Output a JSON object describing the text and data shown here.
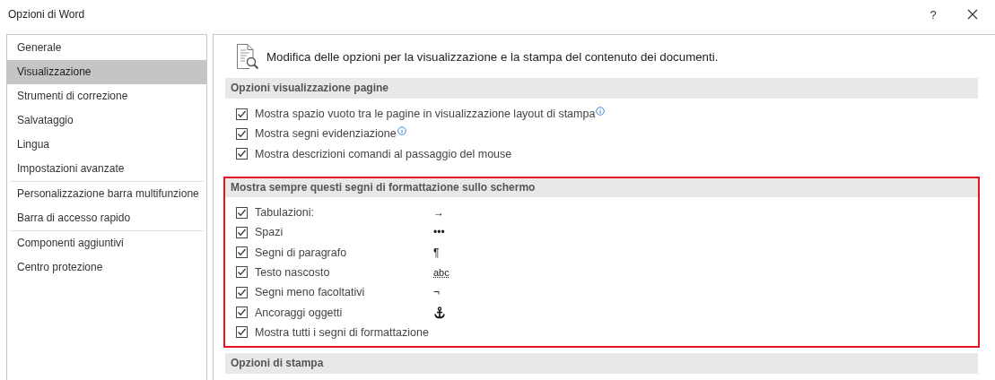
{
  "window": {
    "title": "Opzioni di Word",
    "help": "?"
  },
  "sidebar": {
    "groups": [
      [
        {
          "label": "Generale",
          "selected": false
        },
        {
          "label": "Visualizzazione",
          "selected": true
        },
        {
          "label": "Strumenti di correzione",
          "selected": false
        },
        {
          "label": "Salvataggio",
          "selected": false
        },
        {
          "label": "Lingua",
          "selected": false
        },
        {
          "label": "Impostazioni avanzate",
          "selected": false
        }
      ],
      [
        {
          "label": "Personalizzazione barra multifunzione",
          "selected": false
        },
        {
          "label": "Barra di accesso rapido",
          "selected": false
        }
      ],
      [
        {
          "label": "Componenti aggiuntivi",
          "selected": false
        },
        {
          "label": "Centro protezione",
          "selected": false
        }
      ]
    ]
  },
  "intro": "Modifica delle opzioni per la visualizzazione e la stampa del contenuto dei documenti.",
  "sections": [
    {
      "title": "Opzioni visualizzazione pagine",
      "options": [
        {
          "label": "Mostra spazio vuoto tra le pagine in visualizzazione layout di stampa",
          "checked": true,
          "info": true
        },
        {
          "label": "Mostra segni evidenziazione",
          "checked": true,
          "info": true
        },
        {
          "label": "Mostra descrizioni comandi al passaggio del mouse",
          "checked": true
        }
      ]
    },
    {
      "title": "Mostra sempre questi segni di formattazione sullo schermo",
      "highlighted": true,
      "options": [
        {
          "label": "Tabulazioni:",
          "checked": true,
          "symbol": {
            "kind": "text",
            "text": "→"
          }
        },
        {
          "label": "Spazi",
          "checked": true,
          "symbol": {
            "kind": "text",
            "text": "•••"
          }
        },
        {
          "label": "Segni di paragrafo",
          "checked": true,
          "symbol": {
            "kind": "text",
            "text": "¶"
          }
        },
        {
          "label": "Testo nascosto",
          "checked": true,
          "symbol": {
            "kind": "dotted",
            "text": "abc"
          }
        },
        {
          "label": "Segni meno facoltativi",
          "checked": true,
          "symbol": {
            "kind": "text",
            "text": "¬"
          }
        },
        {
          "label": "Ancoraggi oggetti",
          "checked": true,
          "symbol": {
            "kind": "anchor"
          }
        },
        {
          "label": "Mostra tutti i segni di formattazione",
          "checked": true
        }
      ]
    },
    {
      "title": "Opzioni di stampa"
    }
  ]
}
